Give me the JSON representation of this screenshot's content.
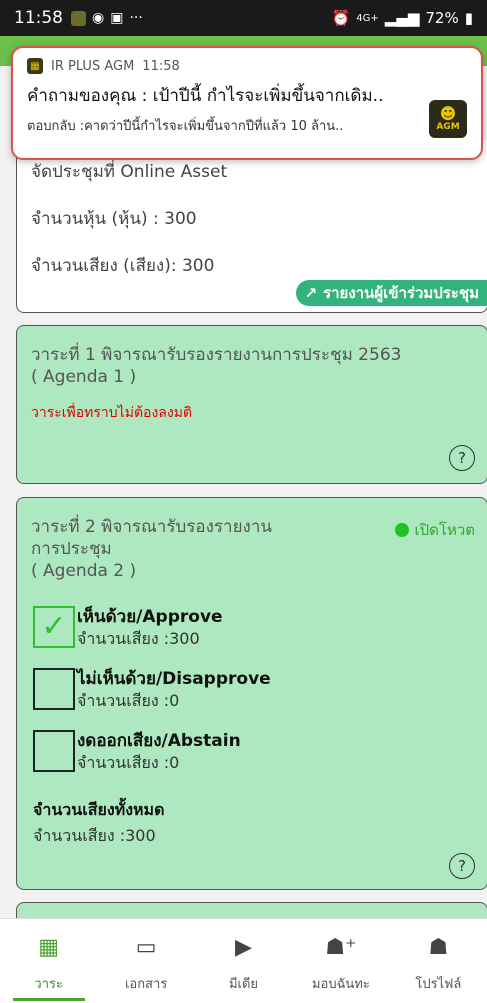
{
  "status_bar": {
    "time": "11:58",
    "dots": "···",
    "network": "4G+",
    "battery": "72%"
  },
  "notification": {
    "app_name": "IR PLUS AGM",
    "time": "11:58",
    "title": "คำถามของคุณ : เป้าปีนี้ กำไรจะเพิ่มขึ้นจากเดิม..",
    "body": "ตอบกลับ :คาดว่าปีนี้กำไรจะเพิ่มขึ้นจากปีที่แล้ว 10 ล้าน..",
    "logo_text": "AGM"
  },
  "info_card": {
    "meeting": "จัดประชุมที่ Online Asset",
    "shares": "จำนวนหุ้น (หุ้น) : 300",
    "votes": "จำนวนเสียง (เสียง): 300",
    "report_button": "รายงานผู้เข้าร่วมประชุม"
  },
  "agenda1": {
    "title": "วาระที่ 1 พิจารณารับรองรายงานการประชุม 2563",
    "subtitle": "( Agenda 1 )",
    "note": "วาระเพื่อทราบไม่ต้องลงมติ",
    "help": "?"
  },
  "agenda2": {
    "title_line1": "วาระที่ 2 พิจารณารับรองรายงาน",
    "title_line2": "การประชุม",
    "subtitle": "( Agenda 2 )",
    "status": "เปิดโหวต",
    "options": [
      {
        "label": "เห็นด้วย/Approve",
        "votes": "จำนวนเสียง :300",
        "checked": true
      },
      {
        "label": "ไม่เห็นด้วย/Disapprove",
        "votes": "จำนวนเสียง :0",
        "checked": false
      },
      {
        "label": "งดออกเสียง/Abstain",
        "votes": "จำนวนเสียง :0",
        "checked": false
      }
    ],
    "total_label": "จำนวนเสียงทั้งหมด",
    "total_votes": "จำนวนเสียง :300",
    "help": "?"
  },
  "nav": {
    "items": [
      {
        "label": "วาระ",
        "icon": "calendar-clock-icon"
      },
      {
        "label": "เอกสาร",
        "icon": "folder-icon"
      },
      {
        "label": "มีเดีย",
        "icon": "media-player-icon"
      },
      {
        "label": "มอบฉันทะ",
        "icon": "add-user-icon"
      },
      {
        "label": "โปรไฟล์",
        "icon": "profile-icon"
      }
    ],
    "active_index": 0
  },
  "colors": {
    "accent_green": "#6cc04a",
    "card_green": "#aee8c0",
    "alert_red": "#e00000",
    "vote_open_green": "#22c022"
  }
}
